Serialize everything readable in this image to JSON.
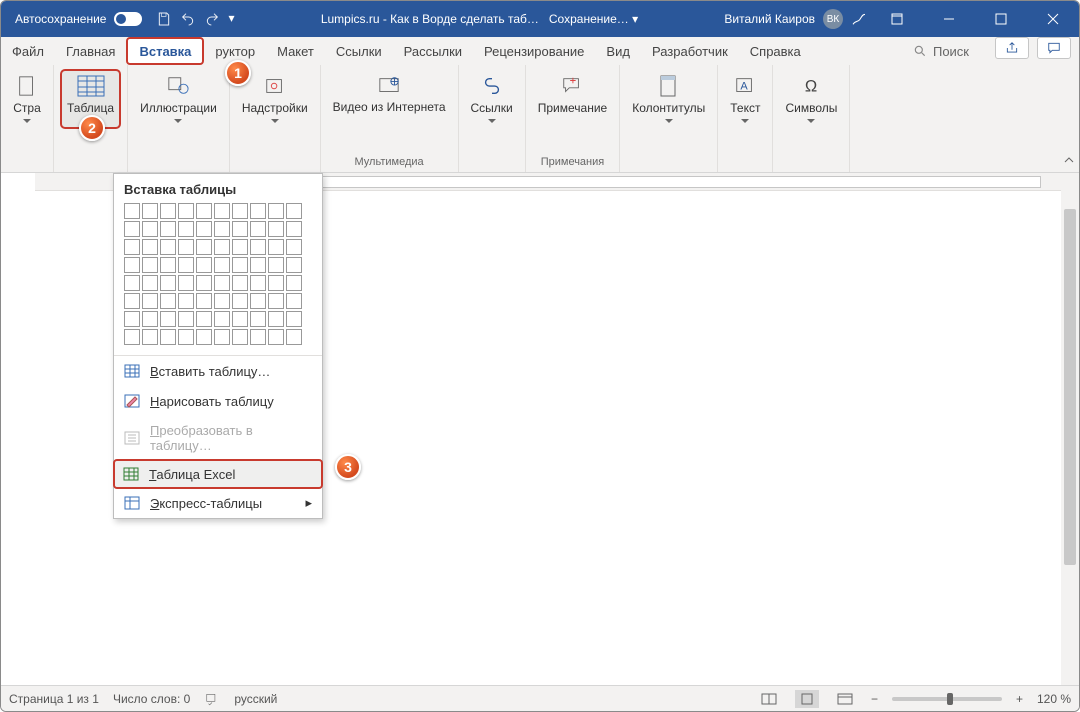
{
  "titlebar": {
    "autosave": "Автосохранение",
    "docname": "Lumpics.ru - Как в Ворде сделать таб…",
    "saving": "Сохранение… ▾",
    "user": "Виталий Каиров",
    "initials": "ВК"
  },
  "tabs": {
    "file": "Файл",
    "home": "Главная",
    "insert": "Вставка",
    "design_suffix": "руктор",
    "layout": "Макет",
    "references": "Ссылки",
    "mailings": "Рассылки",
    "review": "Рецензирование",
    "view": "Вид",
    "developer": "Разработчик",
    "help": "Справка",
    "search": "Поиск"
  },
  "ribbon": {
    "pages_prefix": "Стра",
    "table": "Таблица",
    "illustrations": "Иллюстрации",
    "addins": "Надстройки",
    "video": "Видео из Интернета",
    "media_group": "Мультимедиа",
    "links": "Ссылки",
    "comment": "Примечание",
    "comments_group": "Примечания",
    "headerfooter": "Колонтитулы",
    "text": "Текст",
    "symbols": "Символы"
  },
  "dropdown": {
    "header": "Вставка таблицы",
    "insert_table": "Вставить таблицу…",
    "draw_table": "Нарисовать таблицу",
    "convert": "Преобразовать в таблицу…",
    "excel": "Таблица Excel",
    "quick": "Экспресс-таблицы",
    "u_insert": "В",
    "u_draw": "Н",
    "u_convert": "П",
    "u_excel": "Т",
    "u_quick": "Э"
  },
  "status": {
    "page": "Страница 1 из 1",
    "words": "Число слов: 0",
    "lang": "русский",
    "zoom": "120 %"
  },
  "callouts": {
    "c1": "1",
    "c2": "2",
    "c3": "3"
  }
}
